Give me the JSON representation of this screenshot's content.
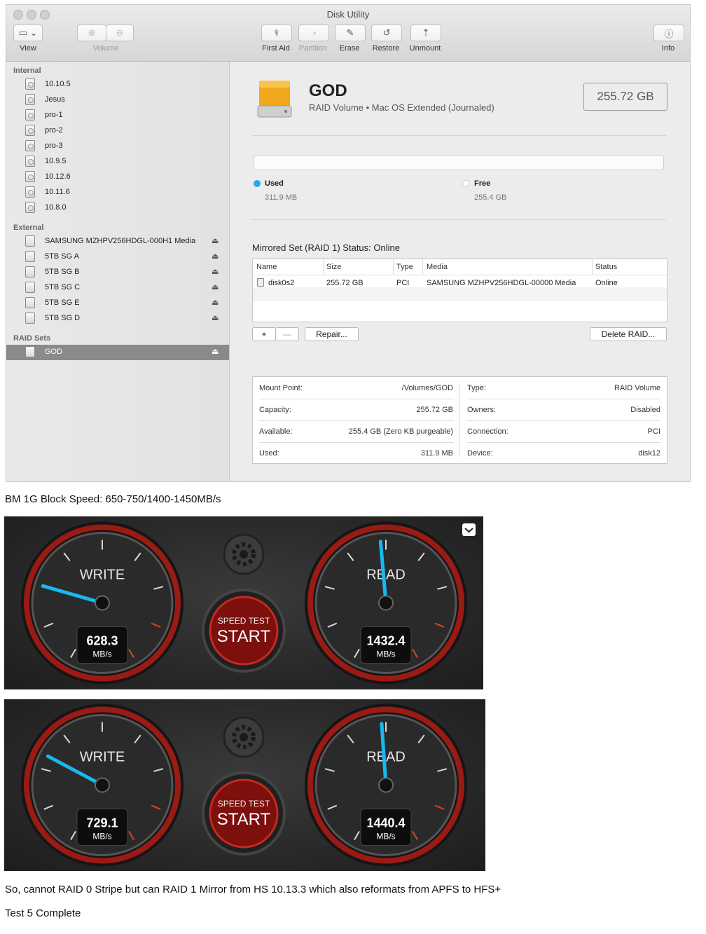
{
  "window": {
    "title": "Disk Utility",
    "toolbar": {
      "view": "View",
      "volume": "Volume",
      "first_aid": "First Aid",
      "partition": "Partition",
      "erase": "Erase",
      "restore": "Restore",
      "unmount": "Unmount",
      "info": "Info"
    }
  },
  "sidebar": {
    "internal_label": "Internal",
    "internal": [
      "10.10.5",
      "Jesus",
      "pro-1",
      "pro-2",
      "pro-3",
      "10.9.5",
      "10.12.6",
      "10.11.6",
      "10.8.0"
    ],
    "external_label": "External",
    "external": [
      "SAMSUNG MZHPV256HDGL-000H1 Media",
      "5TB SG A",
      "5TB SG B",
      "5TB SG C",
      "5TB SG E",
      "5TB SG D"
    ],
    "raid_label": "RAID Sets",
    "raid": [
      "GOD"
    ],
    "eject_glyph": "⏏"
  },
  "volume": {
    "name": "GOD",
    "subtitle": "RAID Volume • Mac OS Extended (Journaled)",
    "capacity": "255.72 GB",
    "used_label": "Used",
    "used_value": "311.9 MB",
    "free_label": "Free",
    "free_value": "255.4 GB",
    "used_color": "#2aa7e8"
  },
  "raid": {
    "status": "Mirrored Set (RAID 1) Status: Online",
    "headers": {
      "name": "Name",
      "size": "Size",
      "type": "Type",
      "media": "Media",
      "status": "Status"
    },
    "row": {
      "name": "disk0s2",
      "size": "255.72 GB",
      "type": "PCI",
      "media": "SAMSUNG MZHPV256HDGL-00000 Media",
      "status": "Online"
    },
    "add": "+",
    "remove": "—",
    "repair": "Repair...",
    "delete": "Delete RAID..."
  },
  "info": {
    "mount_k": "Mount Point:",
    "mount_v": "/Volumes/GOD",
    "capacity_k": "Capacity:",
    "capacity_v": "255.72 GB",
    "available_k": "Available:",
    "available_v": "255.4 GB (Zero KB purgeable)",
    "used_k": "Used:",
    "used_v": "311.9 MB",
    "type_k": "Type:",
    "type_v": "RAID Volume",
    "owners_k": "Owners:",
    "owners_v": "Disabled",
    "connection_k": "Connection:",
    "connection_v": "PCI",
    "device_k": "Device:",
    "device_v": "disk12"
  },
  "text": {
    "bm": "BM 1G Block Speed: 650-750/1400-1450MB/s",
    "note": "So, cannot RAID 0 Stripe but can RAID 1 Mirror from HS 10.13.3 which also reformats from APFS to HFS+",
    "done": "Test 5 Complete"
  },
  "speedtests": [
    {
      "write_label": "WRITE",
      "write_value": "628.3",
      "read_label": "READ",
      "read_value": "1432.4",
      "unit": "MB/s",
      "start_top": "SPEED TEST",
      "start": "START",
      "write_needle_deg": -74,
      "read_needle_deg": -5
    },
    {
      "write_label": "WRITE",
      "write_value": "729.1",
      "read_label": "READ",
      "read_value": "1440.4",
      "unit": "MB/s",
      "start_top": "SPEED TEST",
      "start": "START",
      "write_needle_deg": -62,
      "read_needle_deg": -4
    }
  ]
}
